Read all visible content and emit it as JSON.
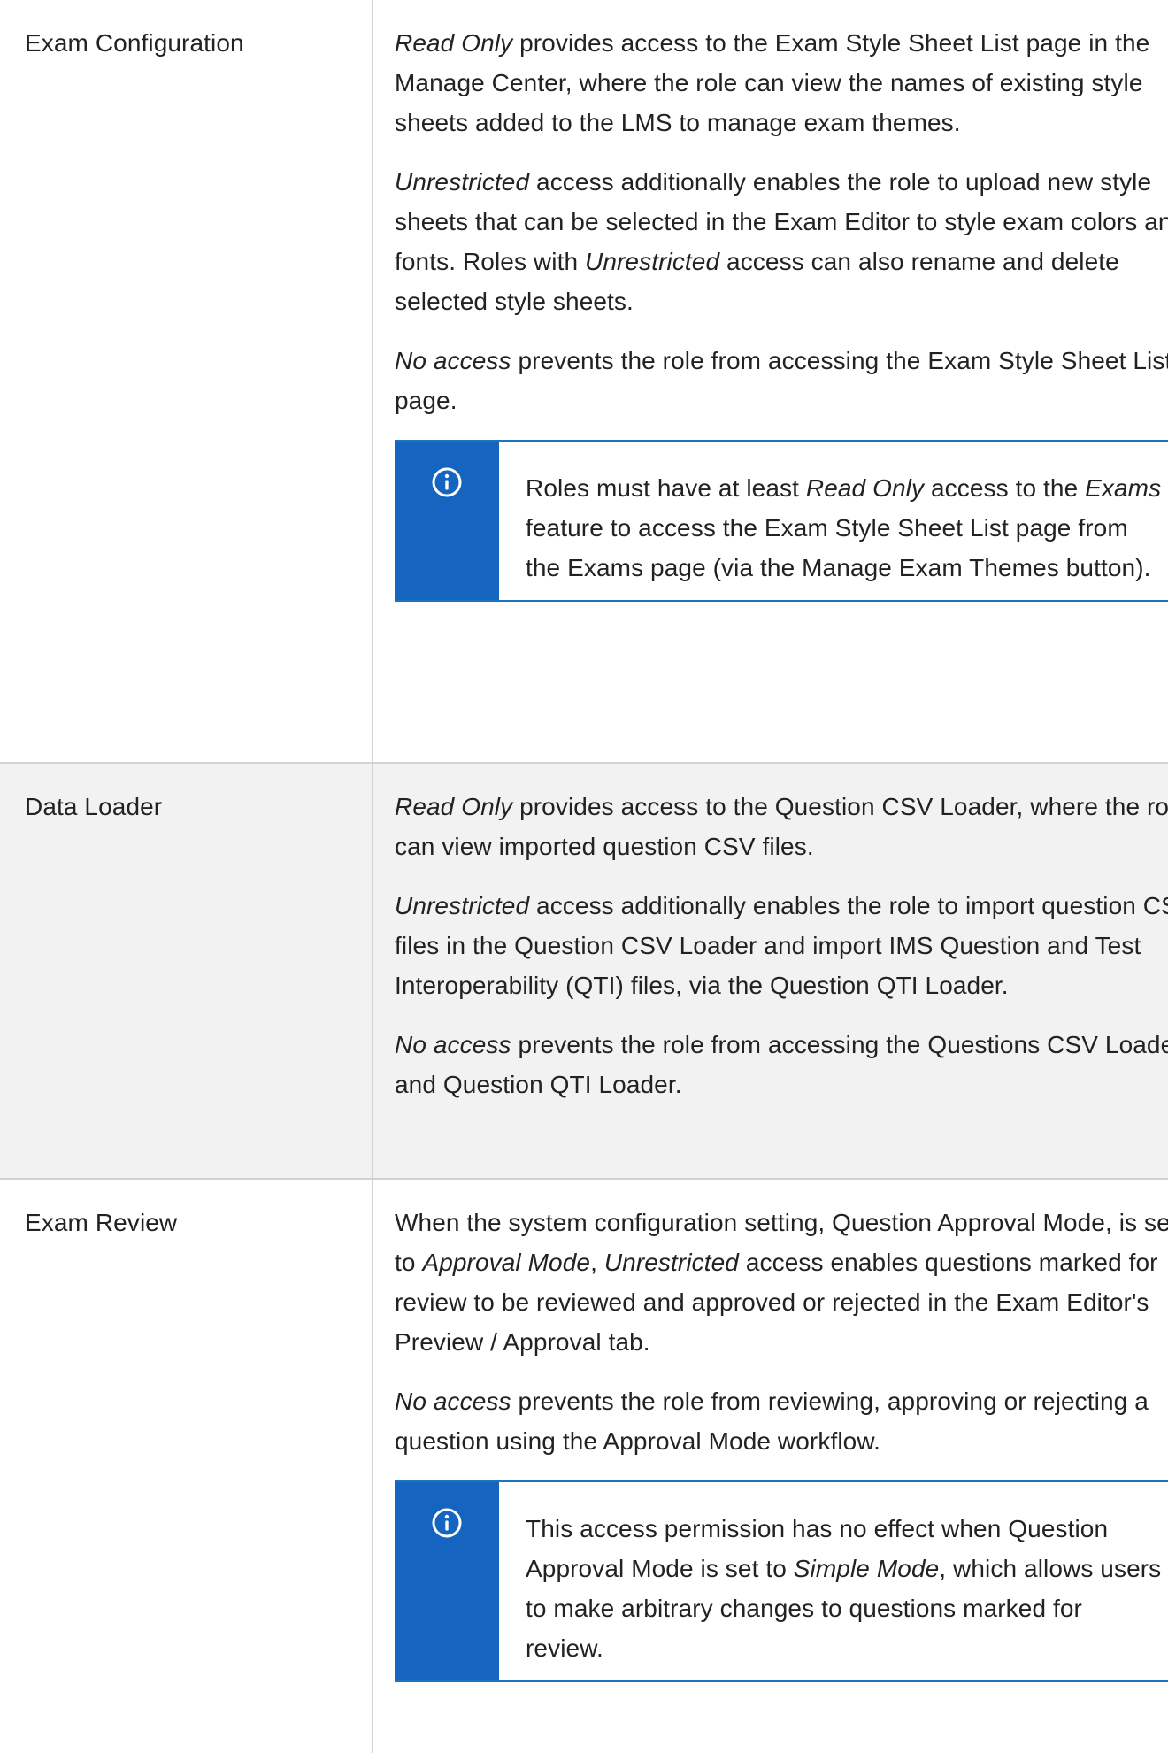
{
  "colors": {
    "note_accent": "#1565c0",
    "border": "#d2d2d2",
    "alt_row_bg": "#f2f2f2"
  },
  "rows": [
    {
      "feature": "Exam Configuration",
      "p1": {
        "em": "Read Only",
        "text": " provides access to the Exam Style Sheet List page in the Manage Center, where the role can view the names of existing style sheets added to the LMS to manage exam themes."
      },
      "p2": {
        "em": "Unrestricted",
        "text_a": " access additionally enables the role to upload new style sheets that can be selected in the Exam Editor to style exam colors and fonts. Roles with ",
        "em2": "Unrestricted",
        "text_b": " access can also rename and delete selected style sheets."
      },
      "p3": {
        "em": "No access",
        "text": " prevents the role from accessing the Exam Style Sheet List page."
      },
      "note": {
        "icon": "info-icon",
        "t1": "Roles must have at least ",
        "em1": "Read Only",
        "t2": " access to the ",
        "em2": "Exams",
        "t3": " feature to access the Exam Style Sheet List page from the Exams page (via the Manage Exam Themes button)."
      }
    },
    {
      "feature": "Data Loader",
      "p1": {
        "em": "Read Only",
        "text": " provides access to the Question CSV Loader, where the role can view imported question CSV files."
      },
      "p2": {
        "em": "Unrestricted",
        "text": " access additionally enables the role to import question CSV files in the Question CSV Loader and import IMS Question and Test Interoperability (QTI) files, via the Question QTI Loader."
      },
      "p3": {
        "em": "No access",
        "text": " prevents the role from accessing the Questions CSV Loader and Question QTI Loader."
      }
    },
    {
      "feature": "Exam Review",
      "p1": {
        "t1": "When the system configuration setting, Question Approval Mode, is set to ",
        "em1": "Approval Mode",
        "t2": ", ",
        "em2": "Unrestricted",
        "t3": " access enables questions marked for review to be reviewed and approved or rejected in the Exam Editor's Preview / Approval tab."
      },
      "p2": {
        "em": "No access",
        "text": " prevents the role from reviewing, approving or rejecting a question using the Approval Mode workflow."
      },
      "note": {
        "icon": "info-icon",
        "t1": "This access permission has no effect when Question Approval Mode is set to ",
        "em1": "Simple Mode",
        "t2": ", which allows users to make arbitrary changes to questions marked for review."
      }
    }
  ]
}
